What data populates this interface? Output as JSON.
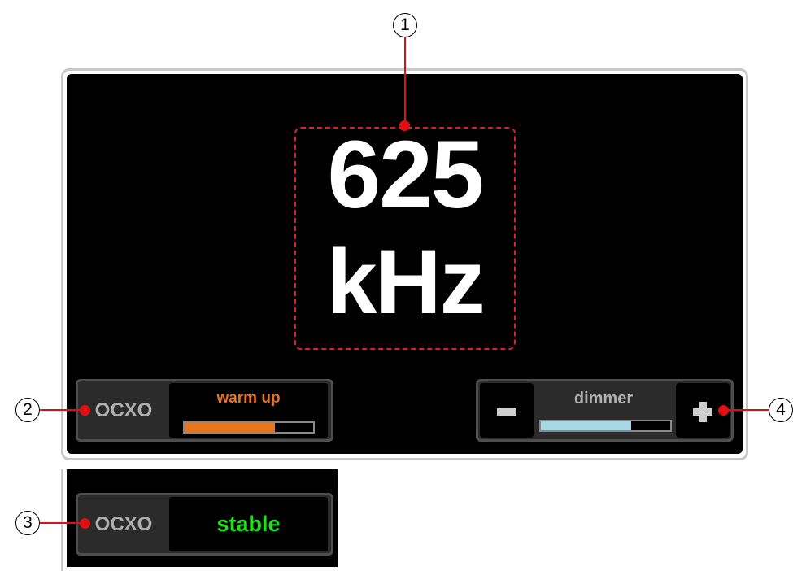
{
  "display": {
    "frequency_value": "625",
    "frequency_unit": "kHz"
  },
  "ocxo_warmup": {
    "label": "OCXO",
    "status_text": "warm up",
    "progress": 0.7,
    "progress_color": "#e8741c"
  },
  "ocxo_stable": {
    "label": "OCXO",
    "status_text": "stable",
    "status_color": "#22dd22"
  },
  "dimmer": {
    "label": "dimmer",
    "decrease_icon": "minus-icon",
    "increase_icon": "plus-icon",
    "level": 0.7,
    "level_color": "#a6d8e6"
  },
  "callouts": [
    "1",
    "2",
    "3",
    "4"
  ],
  "colors": {
    "screen_background": "#000000",
    "callout_line": "#e01010",
    "frame": "#c8c8c8"
  }
}
